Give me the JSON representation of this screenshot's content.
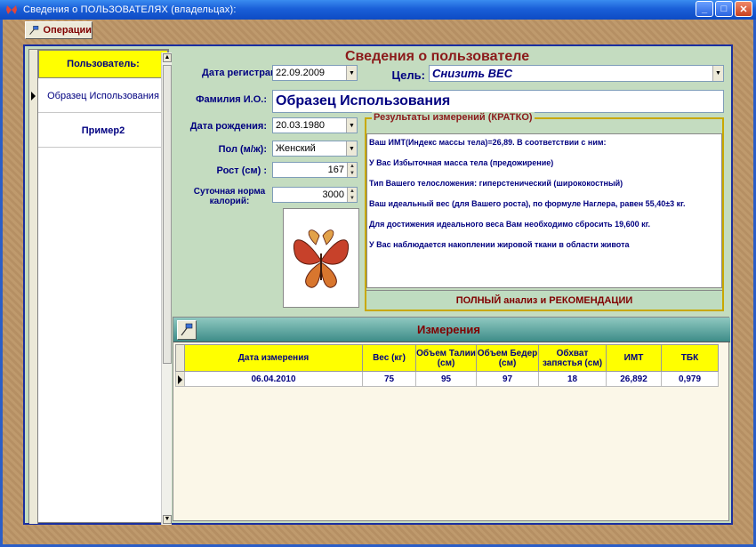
{
  "window": {
    "title": "Сведения о ПОЛЬЗОВАТЕЛЯХ (владельцах):"
  },
  "toolbar": {
    "operations_label": "Операции"
  },
  "users": {
    "header": "Пользователь:",
    "items": [
      {
        "name": "Образец Использования",
        "selected": true
      },
      {
        "name": "Пример2",
        "selected": false
      }
    ]
  },
  "user_info": {
    "title": "Сведения о пользователе",
    "registration_date_label": "Дата регистрации:",
    "registration_date": "22.09.2009",
    "goal_label": "Цель:",
    "goal": "Снизить ВЕС",
    "fio_label": "Фамилия И.О.:",
    "fio": "Образец Использования",
    "birth_date_label": "Дата рождения:",
    "birth_date": "20.03.1980",
    "gender_label": "Пол (м/ж):",
    "gender": "Женский",
    "height_label": "Рост (см) :",
    "height": "167",
    "calories_label": "Суточная норма калорий:",
    "calories": "3000"
  },
  "results": {
    "legend": "Результаты измерений (КРАТКО)",
    "lines": [
      "Ваш ИМТ(Индекс массы тела)=26,89. В соответствии с ним:",
      "У Вас Избыточная масса тела (предожирение)",
      "Тип Вашего телосложения: гиперстенический (ширококостный)",
      "Ваш идеальный вес (для Вашего роста), по формуле Наглера, равен 55,40±3 кг.",
      "Для достижения идеального веса Вам необходимо сбросить 19,600 кг.",
      "У Вас наблюдается накоплении жировой ткани в области живота"
    ],
    "full_button": "ПОЛНЫЙ анализ и РЕКОМЕНДАЦИИ"
  },
  "measurements": {
    "title": "Измерения",
    "columns": [
      "Дата измерения",
      "Вес (кг)",
      "Объем Талии (см)",
      "Объем Бедер (см)",
      "Обхват запястья (см)",
      "ИМТ",
      "ТБК"
    ],
    "rows": [
      [
        "06.04.2010",
        "75",
        "95",
        "97",
        "18",
        "26,892",
        "0,979"
      ]
    ]
  },
  "colors": {
    "accent_title": "#8b1a1a",
    "label": "#000080",
    "header_yellow": "#ffff00",
    "panel": "#c4dcc0"
  }
}
